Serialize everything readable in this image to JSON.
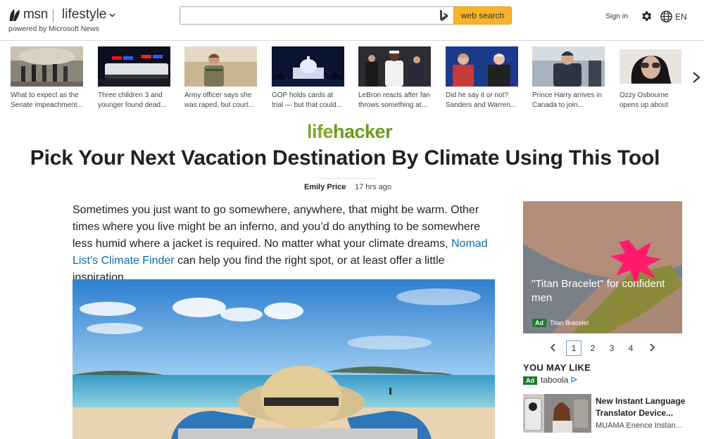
{
  "header": {
    "brand": "msn",
    "section": "lifestyle",
    "powered_by": "powered by Microsoft News",
    "search_placeholder": "",
    "search_button": "web search",
    "sign_in": "Sign in",
    "language": "EN"
  },
  "carousel": [
    {
      "caption": "What to expect as the Senate impeachment..."
    },
    {
      "caption": "Three children 3 and younger found dead..."
    },
    {
      "caption": "Army officer says she was raped, but court..."
    },
    {
      "caption": "GOP holds cards at trial — but that could..."
    },
    {
      "caption": "LeBron reacts after fan throws something at..."
    },
    {
      "caption": "Did he say it or not? Sanders and Warren..."
    },
    {
      "caption": "Prince Harry arrives in Canada to join..."
    },
    {
      "caption": "Ozzy Osbourne opens up about Parkinson's"
    }
  ],
  "article": {
    "source_logo_a": "life",
    "source_logo_b": "hacker",
    "title": "Pick Your Next Vacation Destination By Climate Using This Tool",
    "author": "Emily Price",
    "time": "17 hrs ago",
    "body_before": "Sometimes you just want to go somewhere, anywhere, that might be warm. Other times where you live might be an inferno, and you’d do anything to be somewhere less humid where a jacket is required. No matter what your climate dreams, ",
    "body_link": "Nomad List’s Climate Finder",
    "body_after": " can help you find the right spot, or at least offer a little inspiration."
  },
  "ad": {
    "title": "\"Titan Bracelet\" for confident men",
    "badge": "Ad",
    "brand": "Titan Bracelet"
  },
  "pager": {
    "pages": [
      "1",
      "2",
      "3",
      "4"
    ],
    "current": "1"
  },
  "you_may_like": {
    "heading": "YOU MAY LIKE",
    "badge": "Ad",
    "provider": "taboola",
    "item_title": "New Instant Language Translator Device...",
    "item_source": "MUAMA Enence Instan..."
  },
  "colors": {
    "search_button": "#f5b42b",
    "link": "#0a6ea4",
    "ad_badge": "#1f7a2a",
    "lifehacker": "#7fa82b"
  },
  "icons": [
    "msn-butterfly-icon",
    "chevron-down-icon",
    "bing-icon",
    "gear-icon",
    "globe-icon",
    "chevron-right-icon",
    "chevron-left-icon",
    "taboola-arrow-icon"
  ]
}
